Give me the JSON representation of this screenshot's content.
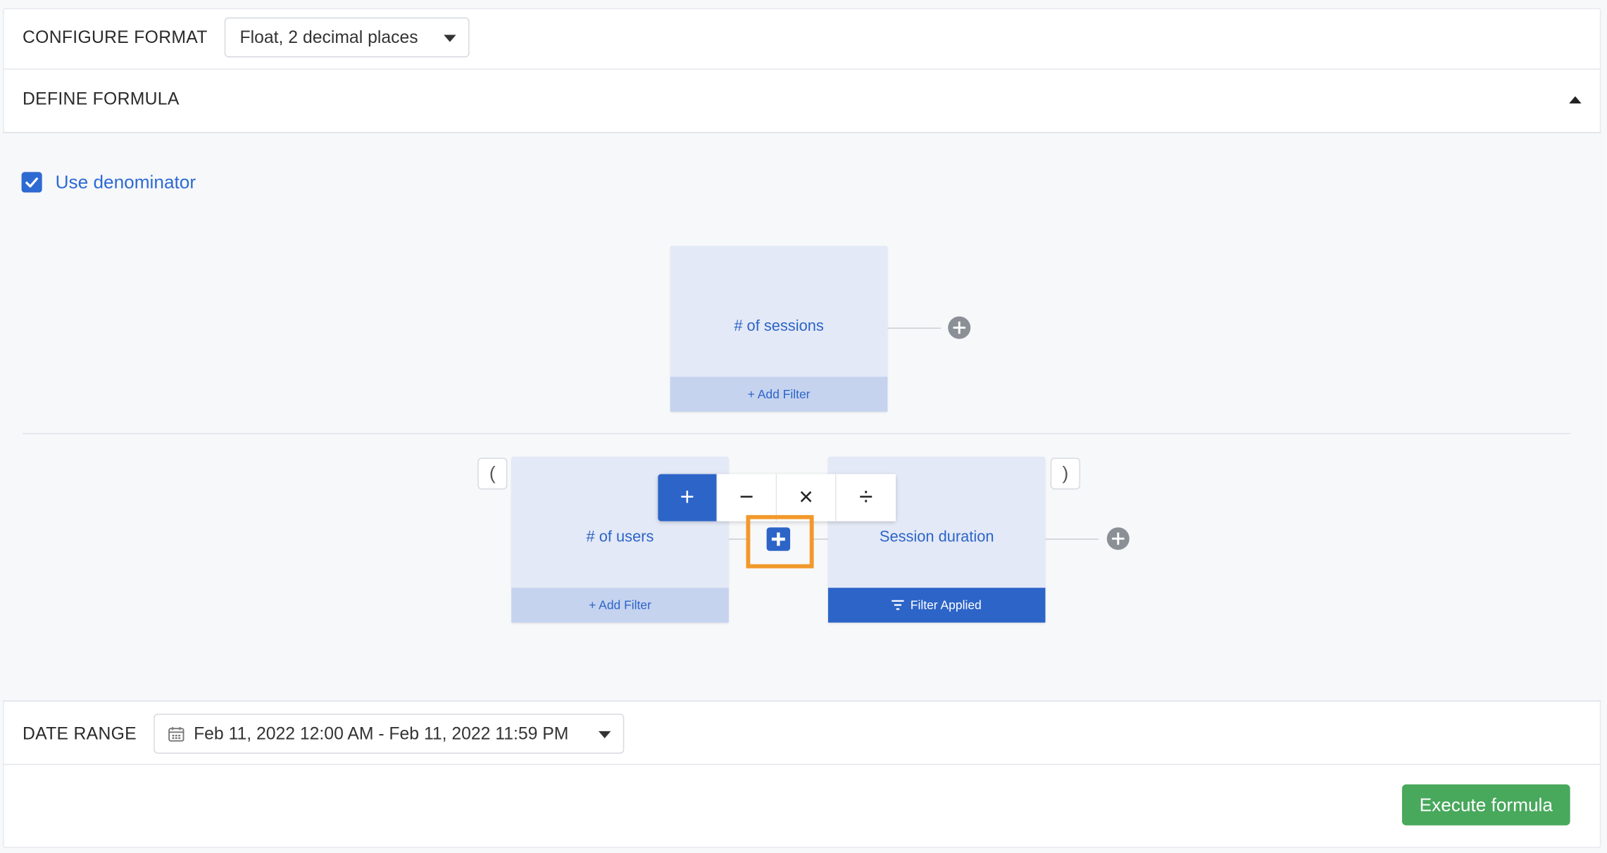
{
  "configure_format": {
    "label": "CONFIGURE FORMAT",
    "selected": "Float, 2 decimal places"
  },
  "define_formula": {
    "label": "DEFINE FORMULA",
    "use_denominator_label": "Use denominator",
    "use_denominator_checked": true,
    "numerator": {
      "metric": "# of sessions",
      "footer": "+ Add Filter"
    },
    "denominator": {
      "open_paren": "(",
      "close_paren": ")",
      "left_metric": "# of users",
      "left_footer": "+ Add Filter",
      "right_metric": "Session duration",
      "right_footer": "Filter Applied",
      "operators": [
        "+",
        "−",
        "×",
        "÷"
      ],
      "active_operator": "+"
    }
  },
  "date_range": {
    "label": "DATE RANGE",
    "value": "Feb 11, 2022 12:00 AM - Feb 11, 2022 11:59 PM"
  },
  "execute_label": "Execute formula",
  "colors": {
    "accent": "#2d64c8",
    "card": "#e3e9f6",
    "card_footer": "#c5d3ef",
    "highlight": "#f2982b",
    "execute": "#48a85c"
  }
}
